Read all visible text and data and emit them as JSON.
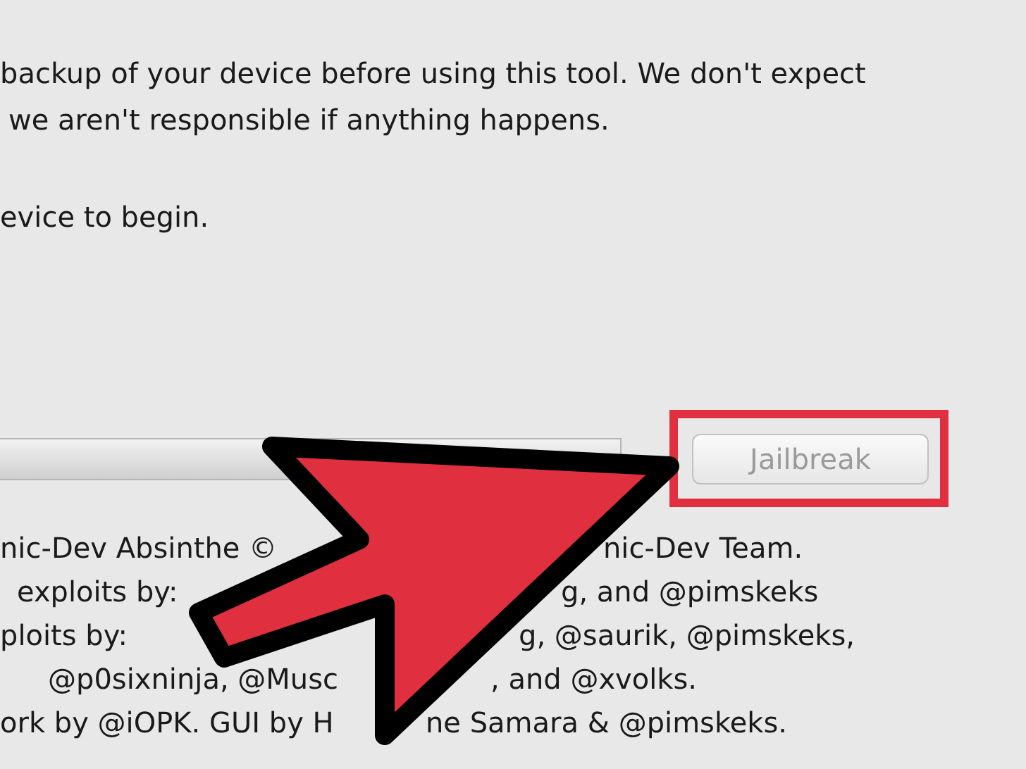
{
  "instructions": [
    "backup of your device before using this tool. We don't expect",
    "we aren't responsible if anything happens.",
    "evice to begin."
  ],
  "progress": {
    "level": 0
  },
  "jailbreak_button": {
    "label": "Jailbreak",
    "disabled": true
  },
  "credits": [
    {
      "left": "nic-Dev Absinthe ©",
      "right": "nic-Dev Team."
    },
    {
      "left": "exploits by:",
      "right": "g, and @pimskeks"
    },
    {
      "left": "ploits by:",
      "right": "g, @saurik, @pimskeks,"
    },
    {
      "left": "@p0sixninja, @Musc",
      "right": ", and @xvolks."
    },
    {
      "left": "ork by @iOPK. GUI by H",
      "right": "ne Samara & @pimskeks."
    }
  ]
}
